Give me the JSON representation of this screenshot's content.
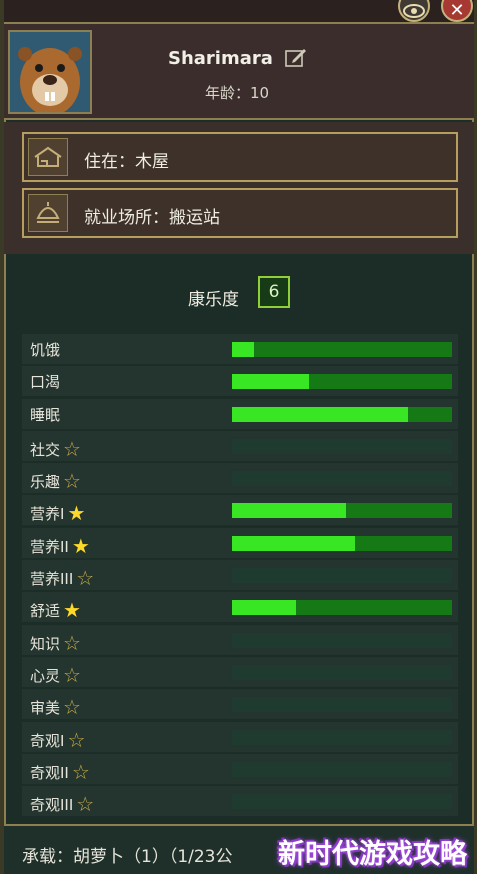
{
  "character": {
    "name": "Sharimara",
    "age_label": "年龄：10"
  },
  "info": {
    "home": "住在：木屋",
    "workplace": "就业场所：搬运站"
  },
  "happiness": {
    "label": "康乐度",
    "value": "6"
  },
  "needs": [
    {
      "label": "饥饿",
      "star": "none",
      "level": 0.1
    },
    {
      "label": "口渴",
      "star": "none",
      "level": 0.35
    },
    {
      "label": "睡眠",
      "star": "none",
      "level": 0.8
    },
    {
      "label": "社交",
      "star": "empty",
      "level": 0
    },
    {
      "label": "乐趣",
      "star": "empty",
      "level": 0
    },
    {
      "label": "营养I",
      "star": "filled",
      "level": 0.52
    },
    {
      "label": "营养II",
      "star": "filled",
      "level": 0.56
    },
    {
      "label": "营养III",
      "star": "empty",
      "level": 0
    },
    {
      "label": "舒适",
      "star": "filled",
      "level": 0.29
    },
    {
      "label": "知识",
      "star": "empty",
      "level": 0
    },
    {
      "label": "心灵",
      "star": "empty",
      "level": 0
    },
    {
      "label": "审美",
      "star": "empty",
      "level": 0
    },
    {
      "label": "奇观I",
      "star": "empty",
      "level": 0
    },
    {
      "label": "奇观II",
      "star": "empty",
      "level": 0
    },
    {
      "label": "奇观III",
      "star": "empty",
      "level": 0
    }
  ],
  "footer": {
    "carrying": "承载：胡萝卜（1）（1/23公"
  },
  "watermark": "新时代游戏攻略",
  "colors": {
    "bar_fill": "#39e624",
    "bar_track_active": "#157a15",
    "star_filled": "#ffd92a",
    "accent_border": "#8d8050"
  },
  "icons": {
    "eye": "eye-icon",
    "close": "close-icon",
    "edit": "edit-icon",
    "home": "house-icon",
    "work": "bell-tower-icon"
  }
}
